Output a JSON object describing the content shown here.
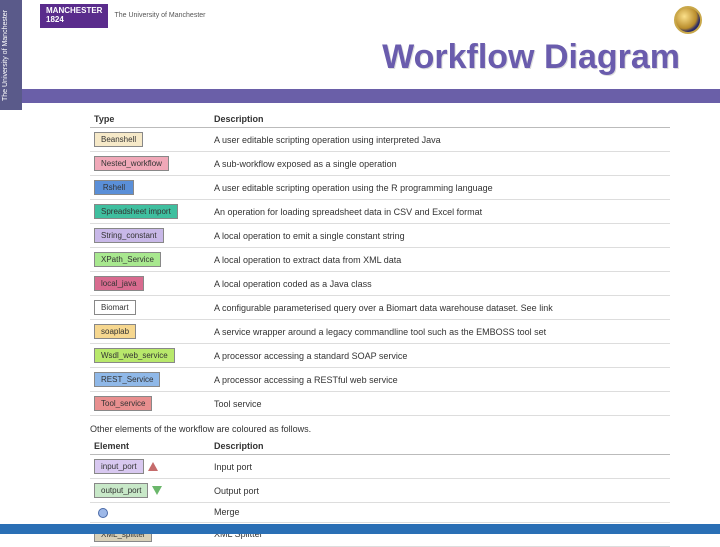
{
  "sidebar_text": "The University of Manchester",
  "logo": {
    "line1": "MANCHESTER",
    "line2": "1824",
    "sub": "The University of Manchester"
  },
  "title": "Workflow Diagram",
  "types_table": {
    "headers": [
      "Type",
      "Description"
    ],
    "rows": [
      {
        "label": "Beanshell",
        "bg": "#f6e9c8",
        "desc": "A user editable scripting operation using interpreted Java"
      },
      {
        "label": "Nested_workflow",
        "bg": "#f0a8b8",
        "desc": "A sub-workflow exposed as a single operation"
      },
      {
        "label": "Rshell",
        "bg": "#5a8fd8",
        "desc": "A user editable scripting operation using the R programming language"
      },
      {
        "label": "Spreadsheet import",
        "bg": "#3fbf9f",
        "desc": "An operation for loading spreadsheet data in CSV and Excel format"
      },
      {
        "label": "String_constant",
        "bg": "#c8b8e8",
        "desc": "A local operation to emit a single constant string"
      },
      {
        "label": "XPath_Service",
        "bg": "#a8e88f",
        "desc": "A local operation to extract data from XML data"
      },
      {
        "label": "local_java",
        "bg": "#d86b8f",
        "desc": "A local operation coded as a Java class"
      },
      {
        "label": "Biomart",
        "bg": "#ffffff",
        "desc": "A configurable parameterised query over a Biomart data warehouse dataset. See link"
      },
      {
        "label": "soaplab",
        "bg": "#f6d78f",
        "desc": "A service wrapper around a legacy commandline tool such as the EMBOSS tool set"
      },
      {
        "label": "Wsdl_web_service",
        "bg": "#b8e86b",
        "desc": "A processor accessing a standard SOAP service"
      },
      {
        "label": "REST_Service",
        "bg": "#8fb8e8",
        "desc": "A processor accessing a RESTful web service"
      },
      {
        "label": "Tool_service",
        "bg": "#e88f8f",
        "desc": "Tool service"
      }
    ]
  },
  "note": "Other elements of the workflow are coloured as follows.",
  "elements_table": {
    "headers": [
      "Element",
      "Description"
    ],
    "rows": [
      {
        "label": "input_port",
        "bg": "#d8c8f0",
        "icon": "tri-up",
        "desc": "Input port"
      },
      {
        "label": "output_port",
        "bg": "#c8e8c8",
        "icon": "tri-down",
        "desc": "Output port"
      },
      {
        "label": "",
        "bg": "",
        "icon": "circle",
        "desc": "Merge"
      },
      {
        "label": "XML_splitter",
        "bg": "#d8d0b8",
        "icon": "",
        "desc": "XML Splitter"
      }
    ]
  }
}
